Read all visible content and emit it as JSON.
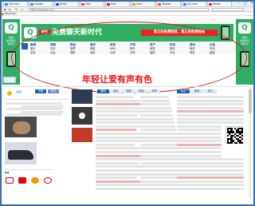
{
  "browser": {
    "menu_label": "MaxThon",
    "address": "http://www.qq.com",
    "tabs": [
      {
        "label": "QQ.com",
        "color": "#2a7fd4"
      },
      {
        "label": "Google",
        "color": "#4285f4"
      },
      {
        "label": "Baidu",
        "color": "#2932e1"
      },
      {
        "label": "Mail",
        "color": "#e44"
      },
      {
        "label": "Sina",
        "color": "#e60012"
      },
      {
        "label": "Sohu",
        "color": "#f39800"
      },
      {
        "label": "Taobao",
        "color": "#ff5000"
      },
      {
        "label": "QQ.com",
        "color": "#2a7fd4"
      },
      {
        "label": "Weibo",
        "color": "#e6162d"
      }
    ],
    "controls": [
      "–",
      "□",
      "×"
    ]
  },
  "banner_ad": {
    "badge": "新版",
    "title": "免费聊天新时代",
    "red_tag": "真正的免费短信，真正的免费视频",
    "left_side_text": [
      "新版",
      "免费聊天",
      "新时代"
    ],
    "right_side_text": [
      "新版",
      "免费聊天",
      "新时代"
    ],
    "qq_glyph": "Q"
  },
  "nav": {
    "headers": [
      "新闻",
      "视频",
      "财经",
      "娱乐",
      "体育",
      "汽车",
      "房产",
      "科技",
      "游戏",
      "女性"
    ],
    "row2": [
      "图片",
      "评论",
      "股票",
      "明星",
      "NBA",
      "购车",
      "家居",
      "数码",
      "网游",
      "时尚"
    ],
    "row3": [
      "军事",
      "社会",
      "理财",
      "电影",
      "中超",
      "试驾",
      "装修",
      "手机",
      "单机",
      "健康"
    ]
  },
  "slogan": "年轻让爱有声有色",
  "content": {
    "weather_city": "北京",
    "side_tabs": [
      "专题",
      "热点"
    ],
    "news_tabs": [
      "要闻",
      "图片",
      "视频",
      "财经",
      "体育"
    ],
    "right_tabs": [
      "热点",
      "推荐",
      "排行"
    ],
    "brand_logos": [
      "新闻客户端",
      "拍拍",
      "QQ旅游",
      "搜狗"
    ]
  },
  "colors": {
    "green": "#2fae64",
    "red": "#e11",
    "blue": "#1f5fb4"
  }
}
